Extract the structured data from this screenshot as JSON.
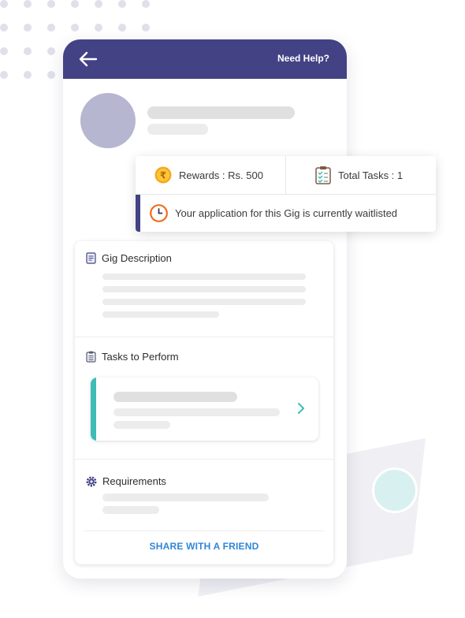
{
  "header": {
    "back_icon": "arrow-left-icon",
    "help_label": "Need Help?",
    "background": "#434285"
  },
  "info_card": {
    "rewards_label": "Rewards : Rs. 500",
    "rewards_icon": "rupee-coin-icon",
    "tasks_label": "Total Tasks : 1",
    "tasks_icon": "checklist-icon",
    "status_label": "Your application for this Gig is currently waitlisted",
    "status_icon": "clock-icon"
  },
  "sections": {
    "gig_description": {
      "title": "Gig Description",
      "icon": "document-icon"
    },
    "tasks": {
      "title": "Tasks to Perform",
      "icon": "clipboard-icon"
    },
    "requirements": {
      "title": "Requirements",
      "icon": "gear-icon"
    }
  },
  "share_label": "SHARE WITH A FRIEND",
  "colors": {
    "primary": "#434285",
    "accent_teal": "#3dbdb5",
    "link_blue": "#2f86d8"
  }
}
